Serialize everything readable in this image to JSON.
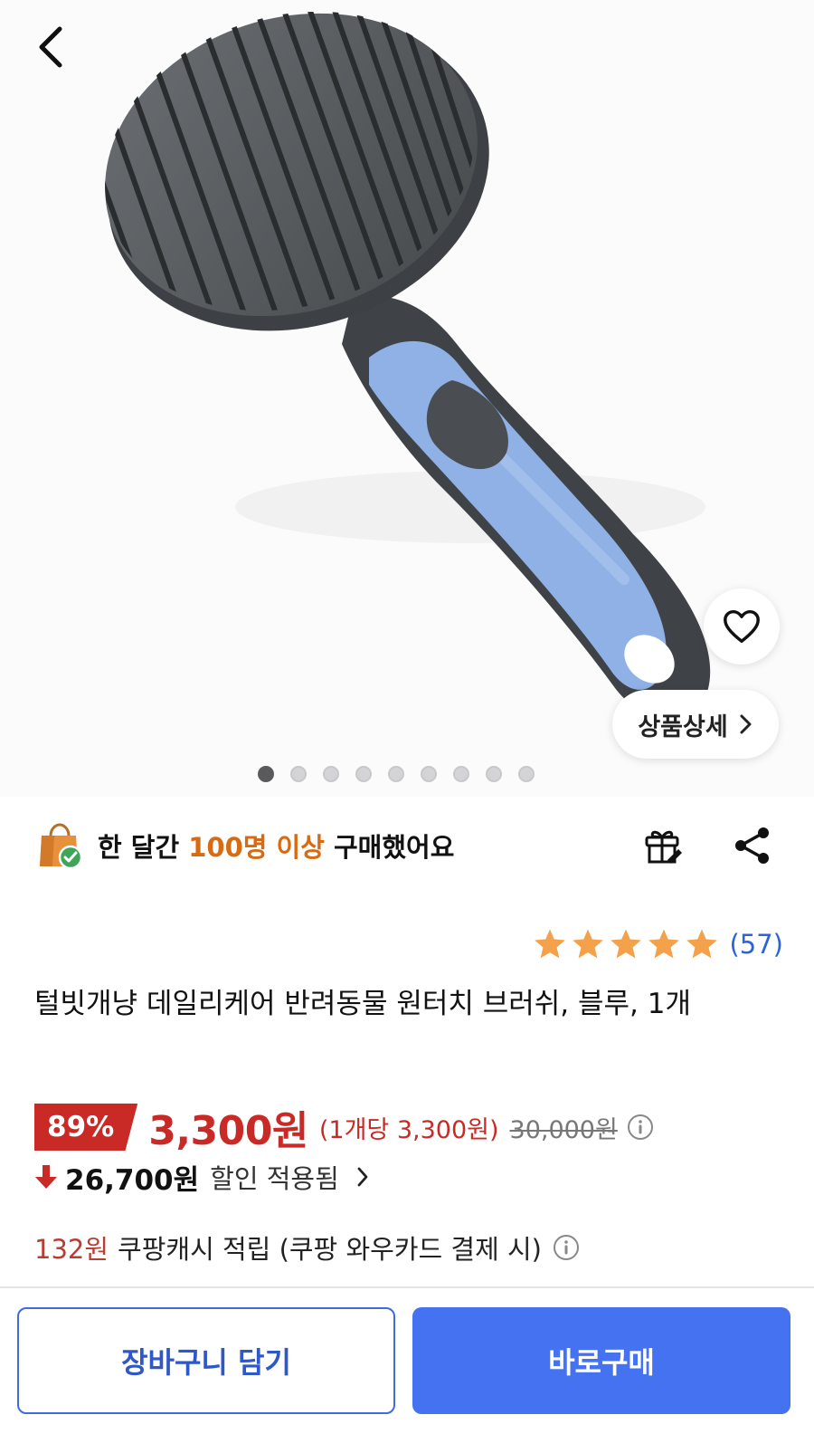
{
  "icons": {
    "back": "chevron-left-icon",
    "wishlist": "heart-icon",
    "detail_chevron": "chevron-right-icon",
    "purchase_badge": "shopping-bag-check-icon",
    "gift": "gift-icon",
    "share": "share-icon",
    "star": "star-icon",
    "info": "info-icon",
    "discount_arrow": "arrow-down-icon"
  },
  "gallery": {
    "image_count": 9,
    "active_index": 0,
    "detail_label": "상품상세"
  },
  "social_proof": {
    "prefix": "한 달간 ",
    "highlight": "100명 이상",
    "suffix": " 구매했어요"
  },
  "rating": {
    "stars": 5,
    "count": "(57)"
  },
  "product": {
    "title": "털빗개냥 데일리케어 반려동물 원터치 브러쉬, 블루, 1개"
  },
  "price": {
    "discount_rate": "89%",
    "sale_price": "3,300원",
    "unit_price": "(1개당 3,300원)",
    "original_price": "30,000원",
    "discount_amount": "26,700원",
    "discount_label": "할인 적용됨"
  },
  "cashback": {
    "amount": "132원",
    "text": "쿠팡캐시 적립 (쿠팡 와우카드 결제 시)"
  },
  "actions": {
    "cart_label": "장바구니 담기",
    "buy_label": "바로구매"
  },
  "colors": {
    "accent_red": "#c92a26",
    "highlight_orange": "#d86a12",
    "star_orange": "#f4a14c",
    "link_blue": "#2d62d8",
    "primary_blue": "#4472f0",
    "brush_blue": "#8fb1e6",
    "brush_gray": "#4f5356"
  }
}
